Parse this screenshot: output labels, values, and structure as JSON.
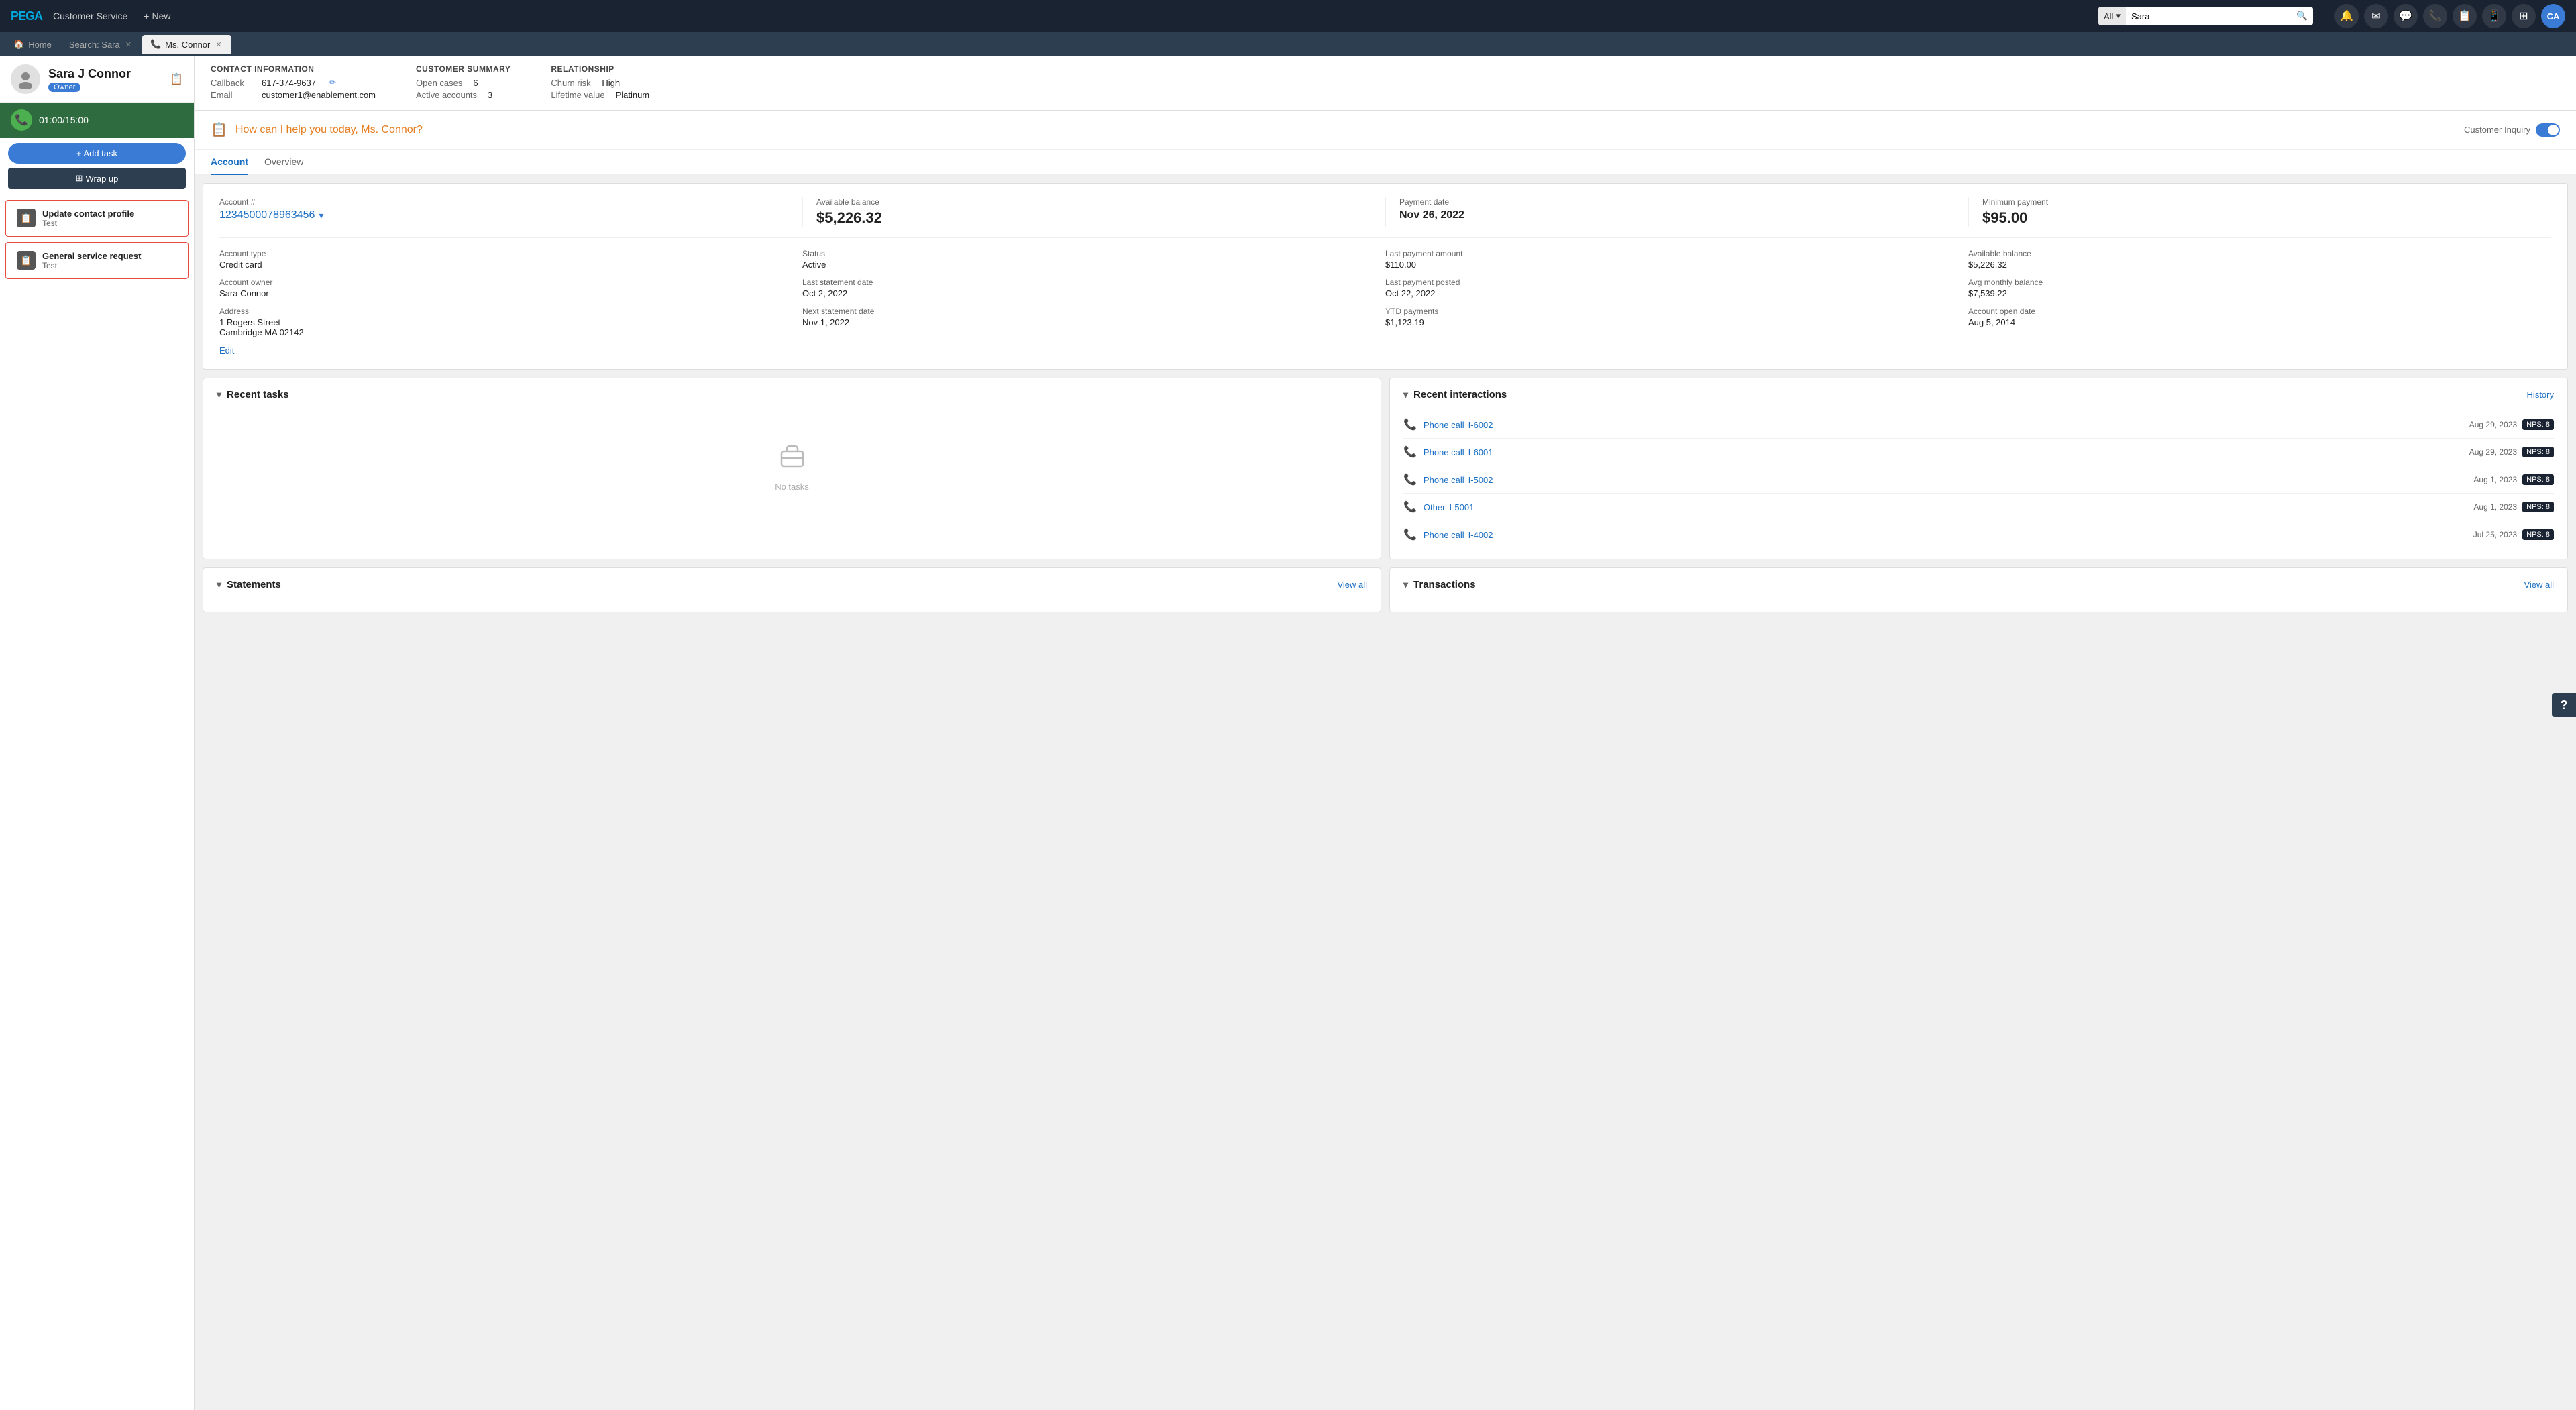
{
  "topNav": {
    "logo": "PEGA",
    "appName": "Customer Service",
    "newLabel": "+ New",
    "searchFilter": "All",
    "searchPlaceholder": "Sara",
    "searchFilterChevron": "▾"
  },
  "navIcons": [
    {
      "name": "bell-icon",
      "symbol": "🔔"
    },
    {
      "name": "mail-icon",
      "symbol": "✉"
    },
    {
      "name": "chat-icon",
      "symbol": "💬"
    },
    {
      "name": "phone-icon",
      "symbol": "📞"
    },
    {
      "name": "tasks-icon",
      "symbol": "📋"
    },
    {
      "name": "phone2-icon",
      "symbol": "📱"
    },
    {
      "name": "apps-icon",
      "symbol": "⊞"
    },
    {
      "name": "user-avatar",
      "symbol": "CA"
    }
  ],
  "tabs": [
    {
      "label": "🏠 Home",
      "active": false,
      "closeable": false
    },
    {
      "label": "Search: Sara",
      "active": false,
      "closeable": true
    },
    {
      "label": "📞 Ms. Connor",
      "active": true,
      "closeable": true
    }
  ],
  "contactInfo": {
    "name": "Sara J Connor",
    "badge": "Owner",
    "callTime": "01:00/15:00",
    "addTaskLabel": "+ Add task",
    "wrapUpLabel": "Wrap up"
  },
  "topInfoBar": {
    "contactSection": {
      "title": "CONTACT INFORMATION",
      "callbackLabel": "Callback",
      "callbackValue": "617-374-9637",
      "emailLabel": "Email",
      "emailValue": "customer1@enablement.com"
    },
    "customerSection": {
      "title": "CUSTOMER SUMMARY",
      "openCasesLabel": "Open cases",
      "openCasesValue": "6",
      "activeAccountsLabel": "Active accounts",
      "activeAccountsValue": "3"
    },
    "relationshipSection": {
      "title": "RELATIONSHIP",
      "churnRiskLabel": "Churn risk",
      "churnRiskValue": "High",
      "lifetimeValueLabel": "Lifetime value",
      "lifetimeValueValue": "Platinum"
    }
  },
  "helpBanner": {
    "text": "How can I help you today, Ms. Connor?",
    "customerInquiryLabel": "Customer Inquiry"
  },
  "contentTabs": [
    {
      "label": "Account",
      "active": true
    },
    {
      "label": "Overview",
      "active": false
    }
  ],
  "accountSection": {
    "accountNumberLabel": "Account #",
    "accountNumber": "1234500078963456",
    "availableBalanceLabel": "Available balance",
    "availableBalance": "$5,226.32",
    "paymentDateLabel": "Payment date",
    "paymentDate": "Nov 26, 2022",
    "minimumPaymentLabel": "Minimum payment",
    "minimumPayment": "$95.00",
    "accountTypeLabel": "Account type",
    "accountTypeValue": "Credit card",
    "accountOwnerLabel": "Account owner",
    "accountOwnerValue": "Sara Connor",
    "addressLabel": "Address",
    "addressLine1": "1 Rogers Street",
    "addressLine2": "Cambridge  MA 02142",
    "editLink": "Edit",
    "statusLabel": "Status",
    "statusValue": "Active",
    "lastStatementDateLabel": "Last statement date",
    "lastStatementDateValue": "Oct 2, 2022",
    "nextStatementDateLabel": "Next statement date",
    "nextStatementDateValue": "Nov 1, 2022",
    "lastPaymentAmountLabel": "Last payment amount",
    "lastPaymentAmountValue": "$110.00",
    "lastPaymentPostedLabel": "Last payment posted",
    "lastPaymentPostedValue": "Oct 22, 2022",
    "ytdPaymentsLabel": "YTD payments",
    "ytdPaymentsValue": "$1,123.19",
    "availableBalanceLabel2": "Available balance",
    "availableBalanceValue2": "$5,226.32",
    "avgMonthlyBalanceLabel": "Avg monthly balance",
    "avgMonthlyBalanceValue": "$7,539.22",
    "accountOpenDateLabel": "Account open date",
    "accountOpenDateValue": "Aug 5, 2014"
  },
  "recentTasks": {
    "title": "Recent tasks",
    "emptyLabel": "No tasks"
  },
  "recentInteractions": {
    "title": "Recent interactions",
    "historyLabel": "History",
    "items": [
      {
        "type": "Phone call",
        "id": "I-6002",
        "date": "Aug 29, 2023",
        "nps": "NPS: 8"
      },
      {
        "type": "Phone call",
        "id": "I-6001",
        "date": "Aug 29, 2023",
        "nps": "NPS: 8"
      },
      {
        "type": "Phone call",
        "id": "I-5002",
        "date": "Aug 1, 2023",
        "nps": "NPS: 8"
      },
      {
        "type": "Other",
        "id": "I-5001",
        "date": "Aug 1, 2023",
        "nps": "NPS: 8"
      },
      {
        "type": "Phone call",
        "id": "I-4002",
        "date": "Jul 25, 2023",
        "nps": "NPS: 8"
      }
    ]
  },
  "statements": {
    "title": "Statements",
    "viewAllLabel": "View all"
  },
  "transactions": {
    "title": "Transactions",
    "viewAllLabel": "View all"
  },
  "sidebarTasks": [
    {
      "title": "Update contact profile",
      "subtitle": "Test"
    },
    {
      "title": "General service request",
      "subtitle": "Test"
    }
  ]
}
